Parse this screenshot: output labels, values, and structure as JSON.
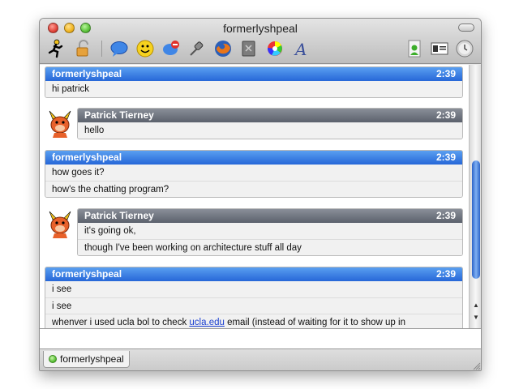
{
  "window": {
    "title": "formerlyshpeal"
  },
  "toolbar": {
    "icons": [
      "runner-icon",
      "lock-icon",
      "message-bubble-icon",
      "smiley-icon",
      "block-icon",
      "pin-icon",
      "firefox-icon",
      "file-icon",
      "color-wheel-icon",
      "font-icon",
      "contact-info-icon",
      "profile-card-icon",
      "clock-icon"
    ]
  },
  "messages": [
    {
      "sender": "formerlyshpeal",
      "time": "2:39",
      "lines": [
        "hi patrick"
      ],
      "style": "blue"
    },
    {
      "sender": "Patrick Tierney",
      "time": "2:39",
      "lines": [
        "hello"
      ],
      "style": "gray"
    },
    {
      "sender": "formerlyshpeal",
      "time": "2:39",
      "lines": [
        "how goes it?",
        "how's the chatting program?"
      ],
      "style": "blue"
    },
    {
      "sender": "Patrick Tierney",
      "time": "2:39",
      "lines": [
        "it's going ok,",
        "though I've been working on architecture stuff all day"
      ],
      "style": "gray"
    },
    {
      "sender": "formerlyshpeal",
      "time": "2:39",
      "lines": [
        "i see",
        "i see"
      ],
      "style": "blue"
    }
  ],
  "last_line": {
    "before": "whenver i used ucla bol to check ",
    "link": "ucla.edu",
    "after": " email (instead of waiting for it to show up in"
  },
  "input": {
    "value": ""
  },
  "tab": {
    "label": "formerlyshpeal"
  },
  "colors": {
    "self_header": "#2f72e0",
    "buddy_header": "#6b707a",
    "scroll_thumb": "#3a74d6"
  }
}
